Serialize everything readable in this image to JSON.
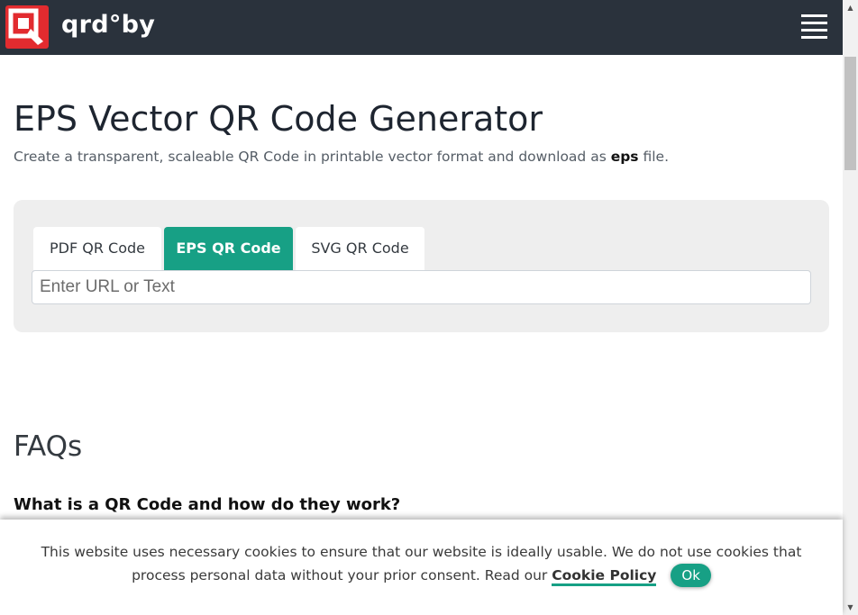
{
  "header": {
    "brand": "qrd°by",
    "logo_icon": "qrdby-logo-icon",
    "menu_icon": "hamburger-menu-icon"
  },
  "main": {
    "title": "EPS Vector QR Code Generator",
    "subtitle_before": "Create a transparent, scaleable QR Code in printable vector format and download as ",
    "subtitle_bold": "eps",
    "subtitle_after": " file."
  },
  "generator": {
    "tabs": [
      {
        "label": "PDF QR Code",
        "active": false
      },
      {
        "label": "EPS QR Code",
        "active": true
      },
      {
        "label": "SVG QR Code",
        "active": false
      }
    ],
    "input_placeholder": "Enter URL or Text",
    "input_value": ""
  },
  "faq": {
    "heading": "FAQs",
    "questions": [
      "What is a QR Code and how do they work?"
    ]
  },
  "cookie_banner": {
    "text": "This website uses necessary cookies to ensure that our website is ideally usable. We do not use cookies that process personal data without your prior consent. Read our ",
    "link_label": "Cookie Policy",
    "ok_label": "Ok"
  },
  "colors": {
    "navbar": "#2a323c",
    "brand_red": "#e22b2f",
    "accent": "#17a085",
    "card_bg": "#eeeeee"
  }
}
